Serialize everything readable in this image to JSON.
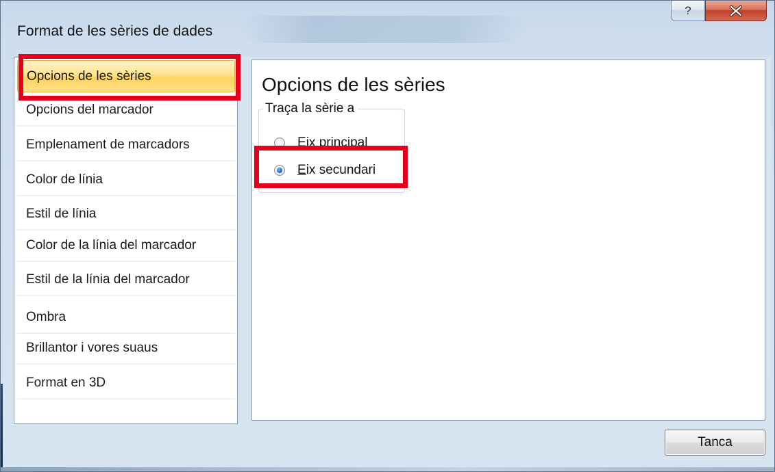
{
  "window": {
    "title": "Format de les sèries de dades",
    "help_symbol": "?",
    "close_symbol": "x"
  },
  "sidebar": {
    "items": [
      {
        "label": "Opcions de les sèries",
        "selected": true
      },
      {
        "label": "Opcions del marcador",
        "selected": false
      },
      {
        "label": "Emplenament de marcadors",
        "selected": false
      },
      {
        "label": "Color de línia",
        "selected": false
      },
      {
        "label": "Estil de línia",
        "selected": false
      },
      {
        "label": "Color de la línia del marcador",
        "selected": false
      },
      {
        "label": "Estil de la línia del marcador",
        "selected": false
      },
      {
        "label": "Ombra",
        "selected": false
      },
      {
        "label": "Brillantor i vores suaus",
        "selected": false
      },
      {
        "label": "Format en 3D",
        "selected": false
      }
    ]
  },
  "main": {
    "section_title": "Opcions de les sèries",
    "group": {
      "legend": "Traça la sèrie a",
      "options": [
        {
          "accel": "E",
          "rest": "ix principal",
          "checked": false
        },
        {
          "accel": "E",
          "rest": "ix secundari",
          "checked": true
        }
      ]
    }
  },
  "footer": {
    "close_label": "Tanca"
  },
  "colors": {
    "highlight_annotation": "#e5001b",
    "selected_item": "#ffd35c",
    "radio_selected": "#2a6fc0"
  }
}
